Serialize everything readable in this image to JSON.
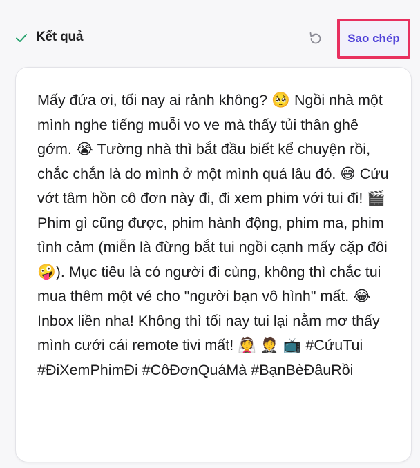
{
  "header": {
    "title": "Kết quả",
    "check_icon": "check-icon",
    "refresh_icon": "refresh-icon",
    "copy_label": "Sao chép"
  },
  "result": {
    "text": "Mấy đứa ơi, tối nay ai rảnh không? 🥺 Ngồi nhà một mình nghe tiếng muỗi vo ve mà thấy tủi thân ghê gớm. 😭 Tường nhà thì bắt đầu biết kể chuyện rồi, chắc chắn là do mình ở một mình quá lâu đó. 😅 Cứu vớt tâm hồn cô đơn này đi, đi xem phim với tui đi! 🎬 Phim gì cũng được, phim hành động, phim ma, phim tình cảm (miễn là đừng bắt tui ngồi cạnh mấy cặp đôi 🤪). Mục tiêu là có người đi cùng, không thì chắc tui mua thêm một vé cho \"người bạn vô hình\" mất. 😂 Inbox liền nha! Không thì tối nay tui lại nằm mơ thấy mình cưới cái remote tivi mất! 👰 🤵 📺 #CứuTui #ĐiXemPhimĐi #CôĐơnQuáMà #BạnBèĐâuRồi"
  },
  "colors": {
    "accent": "#4d3fd8",
    "highlight_border": "#e8305f",
    "check": "#22a06b",
    "text": "#1d1d1f"
  }
}
